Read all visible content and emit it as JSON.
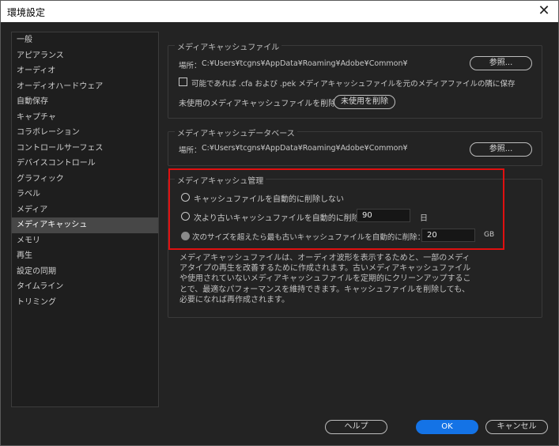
{
  "window": {
    "title": "環境設定",
    "close_glyph": "✕"
  },
  "sidebar": {
    "items": [
      {
        "label": "一般"
      },
      {
        "label": "アピアランス"
      },
      {
        "label": "オーディオ"
      },
      {
        "label": "オーディオハードウェア"
      },
      {
        "label": "自動保存"
      },
      {
        "label": "キャプチャ"
      },
      {
        "label": "コラボレーション"
      },
      {
        "label": "コントロールサーフェス"
      },
      {
        "label": "デバイスコントロール"
      },
      {
        "label": "グラフィック"
      },
      {
        "label": "ラベル"
      },
      {
        "label": "メディア"
      },
      {
        "label": "メディアキャッシュ",
        "selected": true
      },
      {
        "label": "メモリ"
      },
      {
        "label": "再生"
      },
      {
        "label": "設定の同期"
      },
      {
        "label": "タイムライン"
      },
      {
        "label": "トリミング"
      }
    ]
  },
  "cache_files": {
    "title": "メディアキャッシュファイル",
    "location_label": "場所：",
    "location_path": "C:¥Users¥tcgns¥AppData¥Roaming¥Adobe¥Common¥",
    "browse_label": "参照...",
    "save_next_label": "可能であれば .cfa および .pek メディアキャッシュファイルを元のメディアファイルの隣に保存",
    "save_next_checked": false,
    "delete_unused_text": "未使用のメディアキャッシュファイルを削除",
    "delete_unused_button": "未使用を削除"
  },
  "cache_db": {
    "title": "メディアキャッシュデータベース",
    "location_label": "場所：",
    "location_path": "C:¥Users¥tcgns¥AppData¥Roaming¥Adobe¥Common¥",
    "browse_label": "参照..."
  },
  "cache_management": {
    "title": "メディアキャッシュ管理",
    "option_never": "キャッシュファイルを自動的に削除しない",
    "option_older": "次より古いキャッシュファイルを自動的に削除：",
    "older_value": "90",
    "older_unit": "日",
    "option_exceed": "次のサイズを超えたら最も古いキャッシュファイルを自動的に削除：",
    "exceed_value": "20",
    "exceed_unit": "GB",
    "selected_option": "exceed",
    "description": "メディアキャッシュファイルは、オーディオ波形を表示するためと、一部のメディアタイプの再生を改善するために作成されます。古いメディアキャッシュファイルや使用されていないメディアキャッシュファイルを定期的にクリーンアップすることで、最適なパフォーマンスを維持できます。キャッシュファイルを削除しても、必要になれば再作成されます。"
  },
  "footer": {
    "help_label": "ヘルプ",
    "ok_label": "OK",
    "cancel_label": "キャンセル"
  },
  "colors": {
    "accent": "#1473e6",
    "highlight": "#e01010",
    "background": "#232323"
  }
}
